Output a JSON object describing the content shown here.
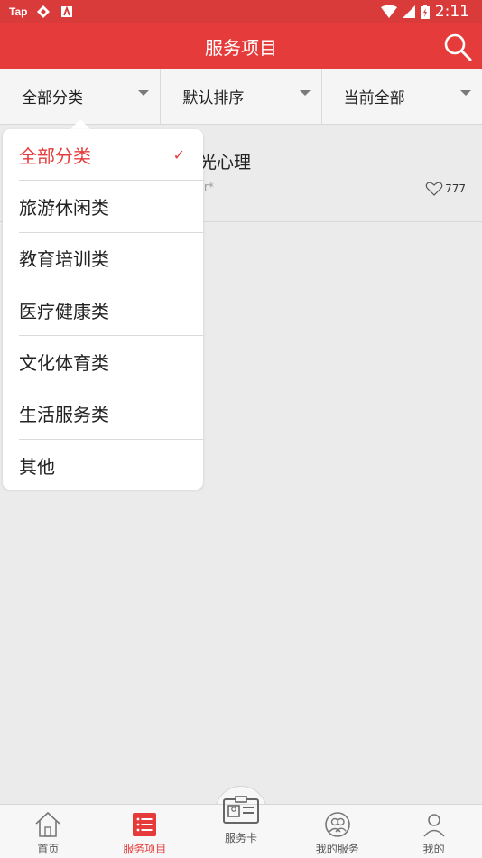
{
  "status_bar": {
    "app_badge": "Tap",
    "time": "2:11"
  },
  "header": {
    "title": "服务项目",
    "search_icon": "search-icon"
  },
  "filters": [
    {
      "label": "全部分类"
    },
    {
      "label": "默认排序"
    },
    {
      "label": "当前全部"
    }
  ],
  "list": {
    "items": [
      {
        "title": "光心理",
        "rating_text": "r*",
        "likes": "777"
      }
    ]
  },
  "dropdown": {
    "items": [
      {
        "label": "全部分类",
        "selected": true
      },
      {
        "label": "旅游休闲类"
      },
      {
        "label": "教育培训类"
      },
      {
        "label": "医疗健康类"
      },
      {
        "label": "文化体育类"
      },
      {
        "label": "生活服务类"
      },
      {
        "label": "其他"
      }
    ],
    "check_mark": "✓"
  },
  "bottom_nav": [
    {
      "label": "首页",
      "icon": "home-icon"
    },
    {
      "label": "服务项目",
      "icon": "list-icon",
      "active": true
    },
    {
      "label": "服务卡",
      "icon": "card-icon"
    },
    {
      "label": "我的服务",
      "icon": "people-icon"
    },
    {
      "label": "我的",
      "icon": "user-icon"
    }
  ],
  "colors": {
    "brand_red": "#e63b3b",
    "status_bar": "#d93a3a",
    "background": "#ebebeb"
  }
}
